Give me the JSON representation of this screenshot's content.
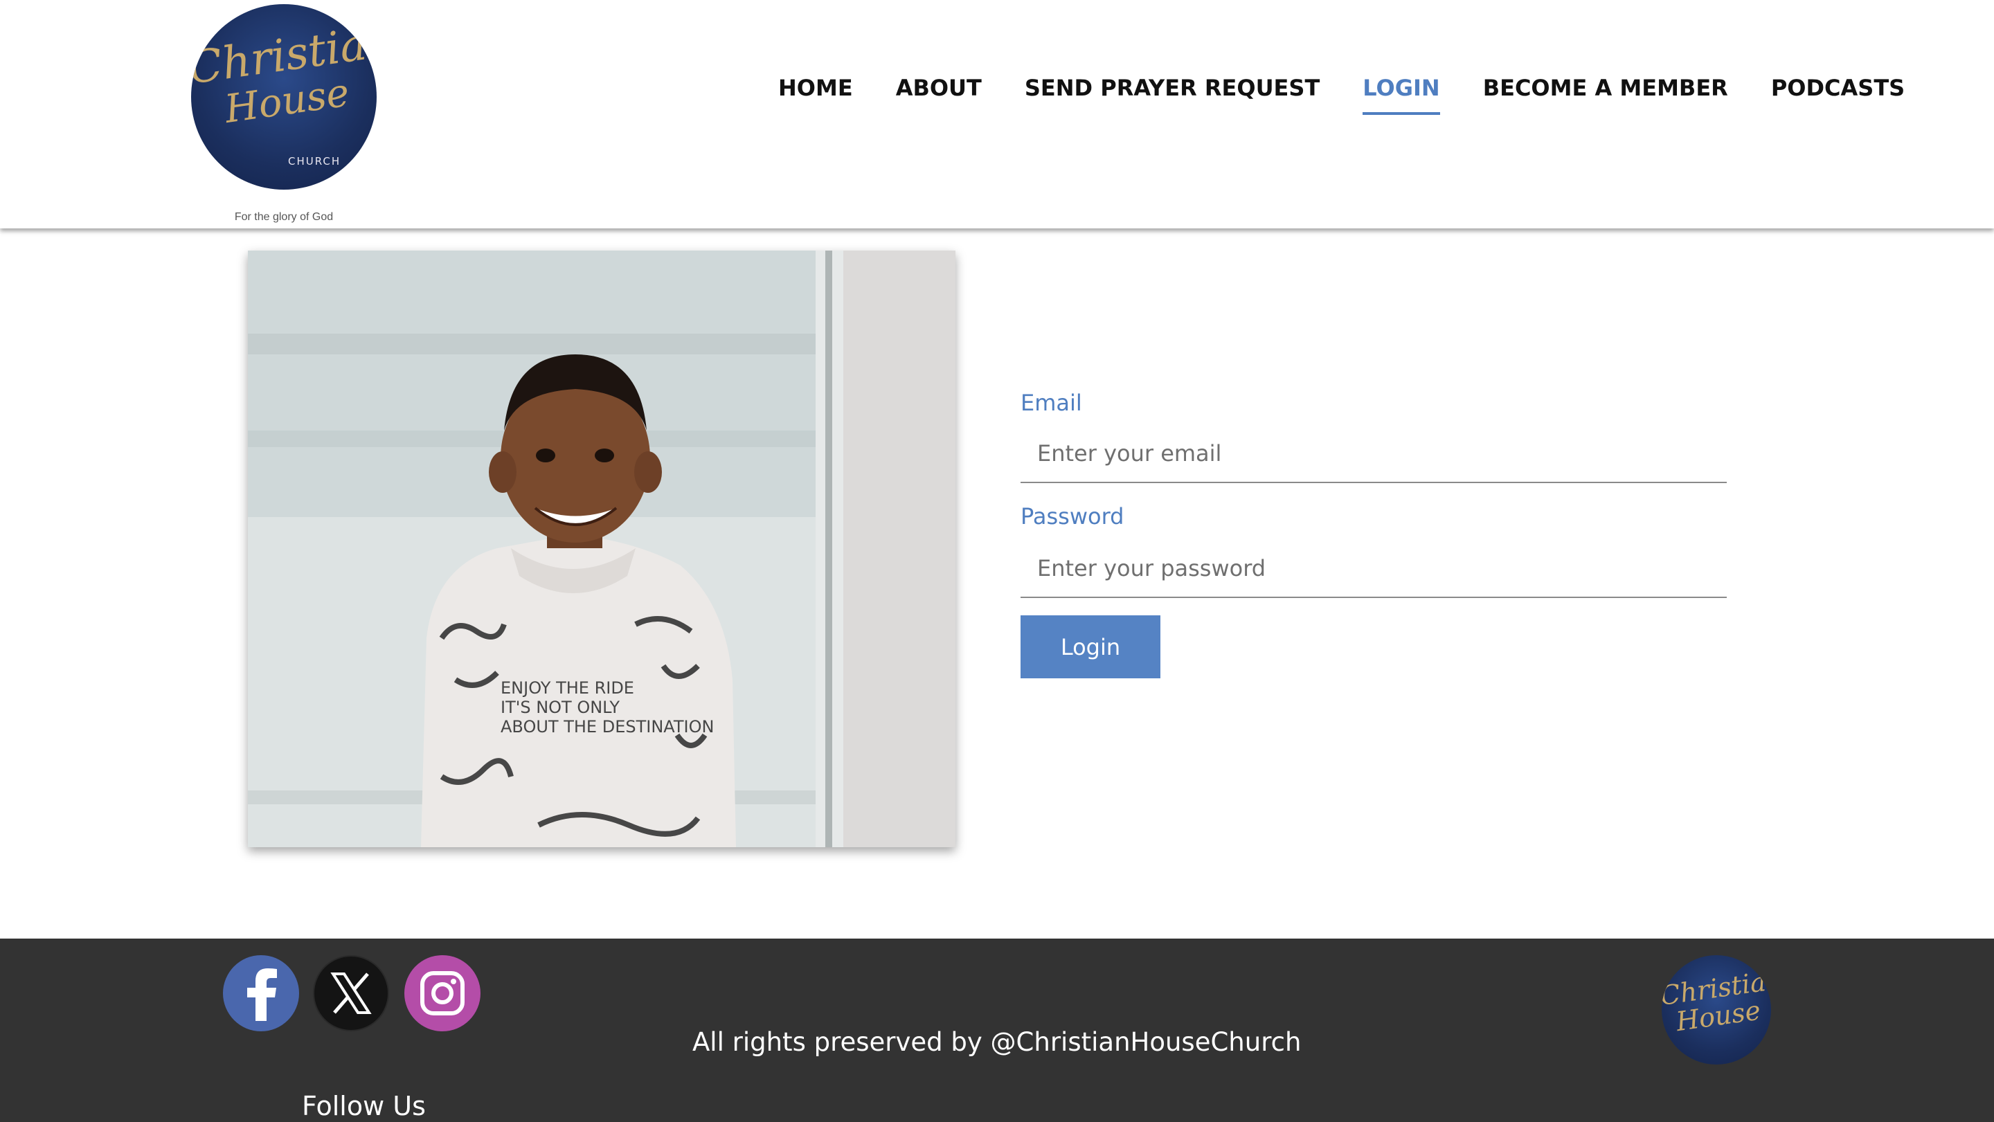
{
  "header": {
    "logo": {
      "line1": "Christian",
      "line2": "House",
      "line3": "CHURCH"
    },
    "tagline": "For the glory of God"
  },
  "nav": {
    "items": [
      {
        "label": "HOME",
        "active": false
      },
      {
        "label": "ABOUT",
        "active": false
      },
      {
        "label": "SEND PRAYER REQUEST",
        "active": false
      },
      {
        "label": "LOGIN",
        "active": true
      },
      {
        "label": "BECOME A MEMBER",
        "active": false
      },
      {
        "label": "PODCASTS",
        "active": false
      }
    ]
  },
  "form": {
    "email_label": "Email",
    "email_placeholder": "Enter your email",
    "email_value": "",
    "password_label": "Password",
    "password_placeholder": "Enter your password",
    "password_value": "",
    "submit_label": "Login"
  },
  "footer": {
    "social_icons": [
      "facebook-icon",
      "x-icon",
      "instagram-icon"
    ],
    "copyright": "All rights preserved by @ChristianHouseChurch",
    "follow_label": "Follow Us",
    "logo": {
      "line1": "Christian",
      "line2": "House"
    }
  },
  "colors": {
    "accent": "#4f7ec0",
    "button": "#5583c4",
    "footer_bg": "#333333",
    "logo_navy": "#1b2f5e",
    "logo_gold": "#c9a96a"
  }
}
